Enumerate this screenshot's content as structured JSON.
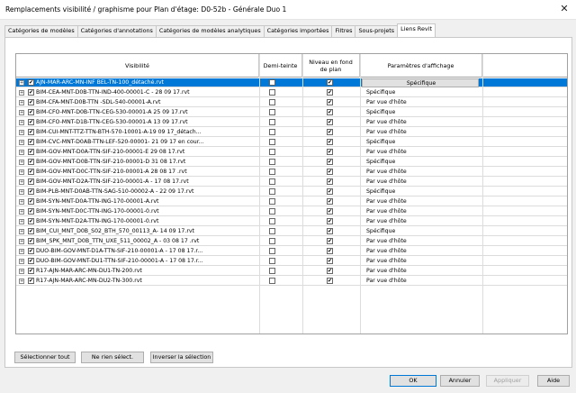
{
  "window": {
    "title": "Remplacements visibilité / graphisme pour Plan d'étage: D0-52b - Générale Duo 1",
    "close_glyph": "✕"
  },
  "tabs": [
    {
      "label": "Catégories de modèles",
      "active": false
    },
    {
      "label": "Catégories d'annotations",
      "active": false
    },
    {
      "label": "Catégories de modèles analytiques",
      "active": false
    },
    {
      "label": "Catégories importées",
      "active": false
    },
    {
      "label": "Filtres",
      "active": false
    },
    {
      "label": "Sous-projets",
      "active": false
    },
    {
      "label": "Liens Revit",
      "active": true
    }
  ],
  "table": {
    "headers": {
      "visibility": "Visibilité",
      "halftone": "Demi-teinte",
      "underlay": "Niveau en fond de plan",
      "display": "Paramètres d'affichage"
    },
    "rows": [
      {
        "name": "AJN-MAR-ARC-MN-INF BEL-TN-100_détaché.rvt",
        "visible": true,
        "halftone": false,
        "underlay": true,
        "display": "Spécifique",
        "selected": true
      },
      {
        "name": "BIM-CEA-MNT-D0B-TTN-IND-400-00001-C - 28 09 17.rvt",
        "visible": true,
        "halftone": false,
        "underlay": true,
        "display": "Spécifique"
      },
      {
        "name": "BIM-CFA-MNT-D0B-TTN -SDL-540-00001-A.rvt",
        "visible": true,
        "halftone": false,
        "underlay": true,
        "display": "Par vue d'hôte"
      },
      {
        "name": "BIM-CFO-MNT-D0B-TTN-CEG-530-00001-A 25 09 17.rvt",
        "visible": true,
        "halftone": false,
        "underlay": true,
        "display": "Spécifique"
      },
      {
        "name": "BIM-CFO-MNT-D1B-TTN-CEG-530-00001-A 13 09 17.rvt",
        "visible": true,
        "halftone": false,
        "underlay": true,
        "display": "Par vue d'hôte"
      },
      {
        "name": "BIM-CUI-MNT-TTZ-TTN-BTH-570-10001-A-19 09 17_détach...",
        "visible": true,
        "halftone": false,
        "underlay": true,
        "display": "Par vue d'hôte"
      },
      {
        "name": "BIM-CVC-MNT-D0AB-TTN-LEF-520-00001- 21 09 17 en cour...",
        "visible": true,
        "halftone": false,
        "underlay": true,
        "display": "Spécifique"
      },
      {
        "name": "BIM-GOV-MNT-D0A-TTN-SIF-210-00001-E 29 08 17.rvt",
        "visible": true,
        "halftone": false,
        "underlay": true,
        "display": "Par vue d'hôte"
      },
      {
        "name": "BIM-GOV-MNT-D0B-TTN-SIF-210-00001-D 31 08 17.rvt",
        "visible": true,
        "halftone": false,
        "underlay": true,
        "display": "Spécifique"
      },
      {
        "name": "BIM-GOV-MNT-D0C-TTN-SIF-210-00001-A 28 08 17 .rvt",
        "visible": true,
        "halftone": false,
        "underlay": true,
        "display": "Par vue d'hôte"
      },
      {
        "name": "BIM-GOV-MNT-D2A-TTN-SIF-210-00001-A - 17 08 17.rvt",
        "visible": true,
        "halftone": false,
        "underlay": true,
        "display": "Par vue d'hôte"
      },
      {
        "name": "BIM-PLB-MNT-D0AB-TTN-SAG-510-00002-A - 22 09 17.rvt",
        "visible": true,
        "halftone": false,
        "underlay": true,
        "display": "Spécifique"
      },
      {
        "name": "BIM-SYN-MNT-D0A-TTN-ING-170-00001-A.rvt",
        "visible": true,
        "halftone": false,
        "underlay": true,
        "display": "Par vue d'hôte"
      },
      {
        "name": "BIM-SYN-MNT-D0C-TTN-ING-170-00001-0.rvt",
        "visible": true,
        "halftone": false,
        "underlay": true,
        "display": "Par vue d'hôte"
      },
      {
        "name": "BIM-SYN-MNT-D2A-TTN-ING-170-00001-0.rvt",
        "visible": true,
        "halftone": false,
        "underlay": true,
        "display": "Par vue d'hôte"
      },
      {
        "name": "BIM_CUI_MNT_D0B_S02_BTH_570_00113_A- 14 09 17.rvt",
        "visible": true,
        "halftone": false,
        "underlay": true,
        "display": "Spécifique"
      },
      {
        "name": "BIM_SPK_MNT_D0B_TTN_UXE_511_00002_A - 03 08 17 .rvt",
        "visible": true,
        "halftone": false,
        "underlay": true,
        "display": "Par vue d'hôte"
      },
      {
        "name": "DUO-BIM-GOV-MNT-D1A-TTN-SIF-210-00001-A - 17 08 17.r...",
        "visible": true,
        "halftone": false,
        "underlay": true,
        "display": "Par vue d'hôte"
      },
      {
        "name": "DUO-BIM-GOV-MNT-DU1-TTN-SIF-210-00001-A - 17 08 17.r...",
        "visible": true,
        "halftone": false,
        "underlay": true,
        "display": "Par vue d'hôte"
      },
      {
        "name": "R17-AJN-MAR-ARC-MN-DU1-TN-200.rvt",
        "visible": true,
        "halftone": false,
        "underlay": true,
        "display": "Par vue d'hôte"
      },
      {
        "name": "R17-AJN-MAR-ARC-MN-DU2-TN-300.rvt",
        "visible": true,
        "halftone": false,
        "underlay": true,
        "display": "Par vue d'hôte"
      }
    ]
  },
  "selection_buttons": {
    "select_all": "Sélectionner tout",
    "select_none": "Ne rien sélect.",
    "invert": "Inverser la sélection"
  },
  "dialog_buttons": {
    "ok": "OK",
    "cancel": "Annuler",
    "apply": "Appliquer",
    "help": "Aide"
  },
  "colors": {
    "selection": "#0078d7"
  }
}
